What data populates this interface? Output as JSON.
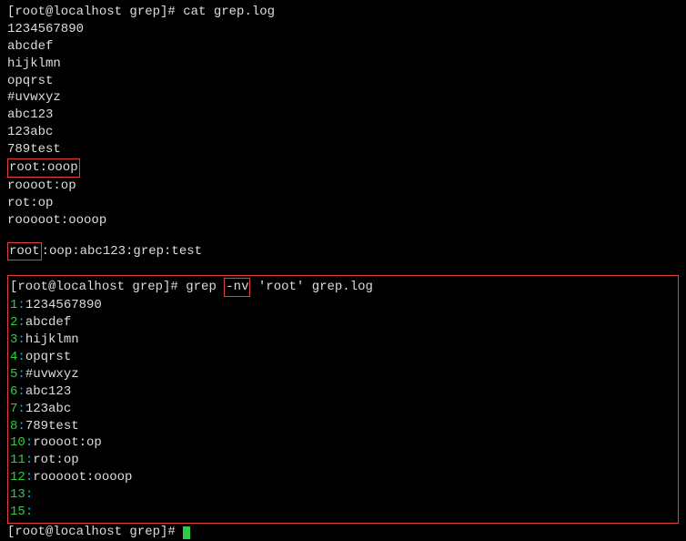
{
  "prompt1": "[root@localhost grep]#",
  "cmd1": "cat grep.log",
  "file_lines": [
    "1234567890",
    "abcdef",
    "hijklmn",
    "opqrst",
    "#uvwxyz",
    "abc123",
    "123abc",
    "789test"
  ],
  "highlighted_line1": "root:ooop",
  "after_highlight1": [
    "roooot:op",
    "rot:op",
    "rooooot:oooop"
  ],
  "line2_prefix": "root",
  "line2_suffix": ":oop:abc123:grep:test",
  "prompt2": "[root@localhost grep]#",
  "cmd2_pre": "grep ",
  "cmd2_flag": "-nv",
  "cmd2_post": " 'root' grep.log",
  "grep_output": [
    {
      "num": "1",
      "text": "1234567890"
    },
    {
      "num": "2",
      "text": "abcdef"
    },
    {
      "num": "3",
      "text": "hijklmn"
    },
    {
      "num": "4",
      "text": "opqrst"
    },
    {
      "num": "5",
      "text": "#uvwxyz"
    },
    {
      "num": "6",
      "text": "abc123"
    },
    {
      "num": "7",
      "text": "123abc"
    },
    {
      "num": "8",
      "text": "789test"
    },
    {
      "num": "10",
      "text": "roooot:op"
    },
    {
      "num": "11",
      "text": "rot:op"
    },
    {
      "num": "12",
      "text": "rooooot:oooop"
    },
    {
      "num": "13",
      "text": ""
    },
    {
      "num": "15",
      "text": ""
    }
  ],
  "prompt3": "[root@localhost grep]#"
}
